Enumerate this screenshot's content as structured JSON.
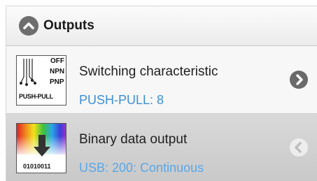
{
  "header": {
    "title": "Outputs",
    "toggle_icon": "chevron-up-icon"
  },
  "rows": [
    {
      "name": "Switching characteristic",
      "value": "PUSH-PULL: 8",
      "icon": "switching-output-icon",
      "icon_labels": [
        "OFF",
        "NPN",
        "PNP",
        "PUSH-PULL"
      ],
      "arrow_icon": "chevron-right-icon",
      "expanded": false
    },
    {
      "name": "Binary data output",
      "value": "USB: 200: Continuous",
      "icon": "binary-data-icon",
      "icon_labels": [
        "01010011"
      ],
      "arrow_icon": "chevron-left-icon",
      "expanded": true
    }
  ],
  "colors": {
    "value_text": "#3d8fd6",
    "header_icon": "#6e6e6e",
    "selected_row": "#cfcfcf"
  }
}
